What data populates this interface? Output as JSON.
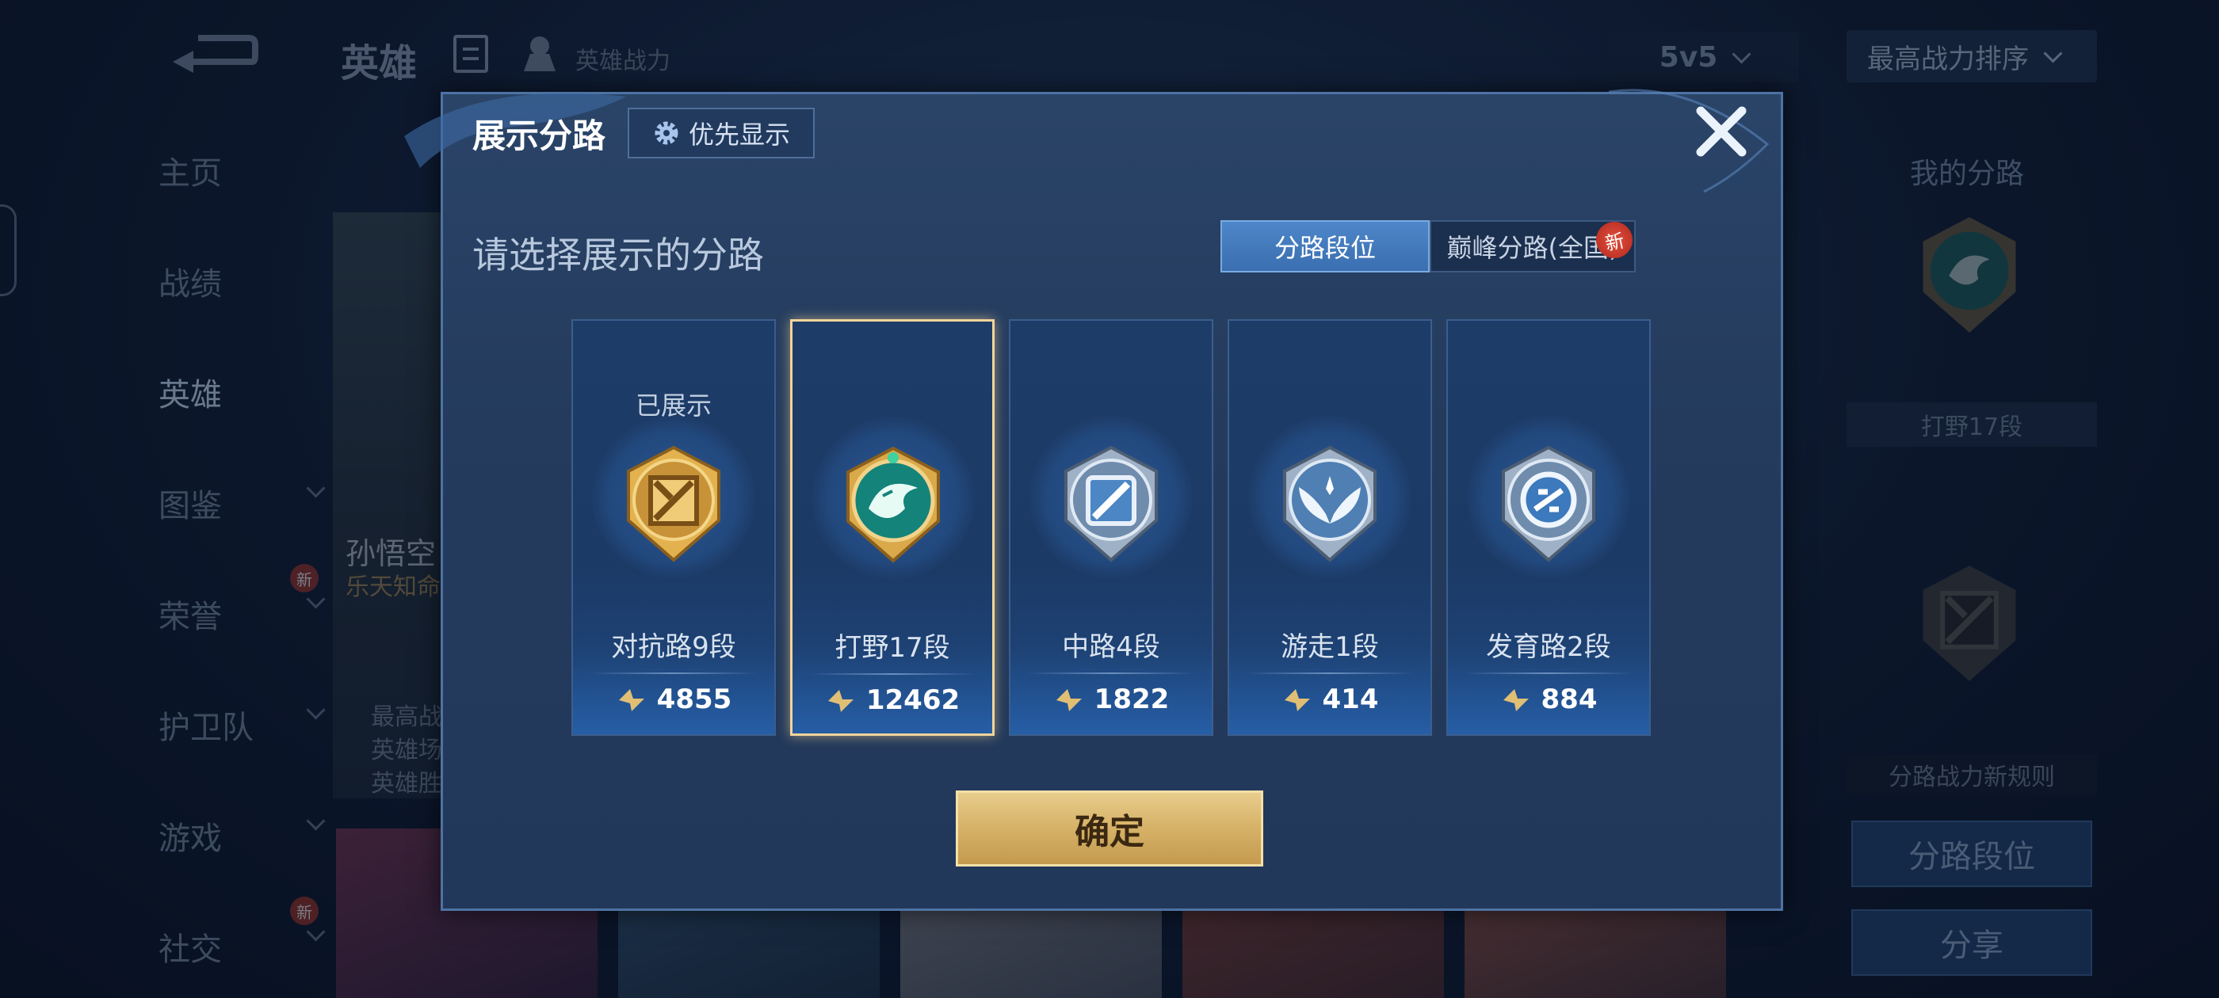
{
  "header": {
    "title": "英雄",
    "subtitle": "英雄战力",
    "mode": "5v5",
    "sort": "最高战力排序"
  },
  "sidebar": {
    "items": [
      {
        "label": "主页"
      },
      {
        "label": "战绩"
      },
      {
        "label": "英雄"
      },
      {
        "label": "图鉴"
      },
      {
        "label": "荣誉"
      },
      {
        "label": "护卫队"
      },
      {
        "label": "游戏"
      },
      {
        "label": "社交"
      }
    ],
    "new_badge": "新"
  },
  "hero": {
    "name": "孙悟空",
    "subtitle": "乐天知命",
    "stats": [
      "最高战",
      "英雄场",
      "英雄胜"
    ]
  },
  "right_panel": {
    "title": "我的分路",
    "lane_label": "打野17段",
    "rule_label": "分路战力新规则",
    "lane_rank_button": "分路段位",
    "share_button": "分享"
  },
  "modal": {
    "title": "展示分路",
    "priority_button": "优先显示",
    "subtitle": "请选择展示的分路",
    "tabs": {
      "active": "分路段位",
      "inactive": "巅峰分路(全国)",
      "new_badge": "新"
    },
    "shown_label": "已展示",
    "lanes": [
      {
        "name": "对抗路9段",
        "power": "4855"
      },
      {
        "name": "打野17段",
        "power": "12462"
      },
      {
        "name": "中路4段",
        "power": "1822"
      },
      {
        "name": "游走1段",
        "power": "414"
      },
      {
        "name": "发育路2段",
        "power": "884"
      }
    ],
    "confirm_button": "确定"
  },
  "colors": {
    "accent_gold": "#d7b46a",
    "selected_border": "#f2d49a",
    "tab_active": "#4d86c9",
    "new_badge": "#c8352a"
  }
}
